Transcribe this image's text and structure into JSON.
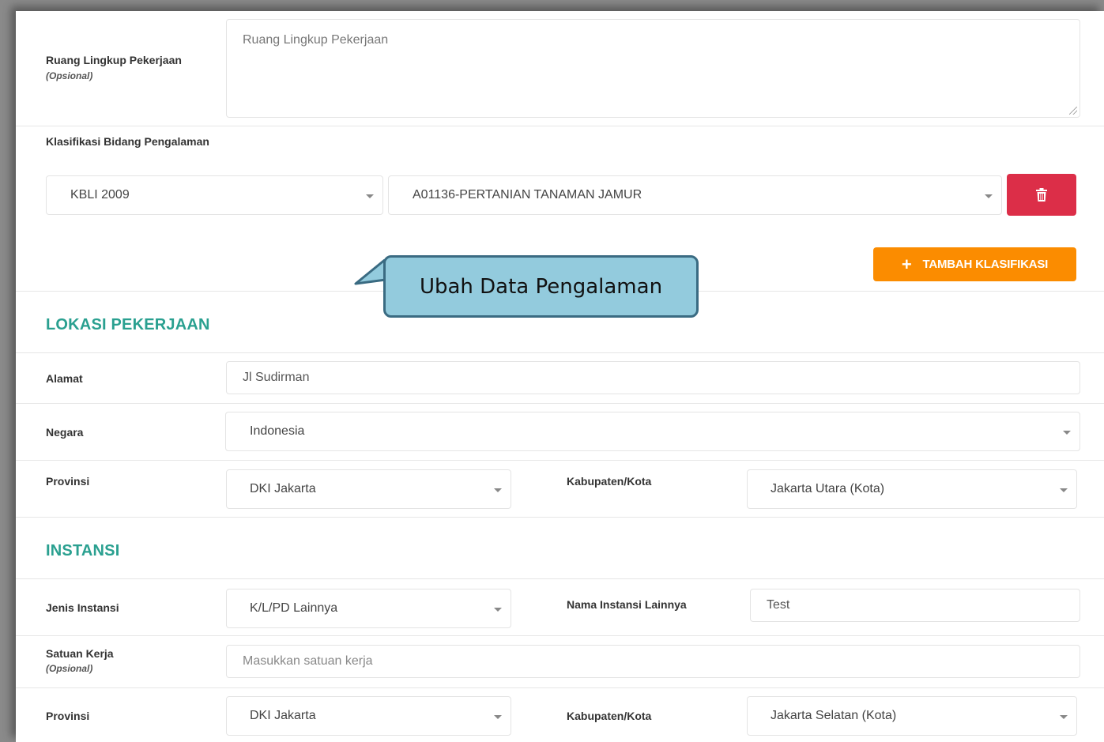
{
  "scope": {
    "label": "Ruang Lingkup Pekerjaan",
    "note": "(Opsional)",
    "placeholder": "Ruang Lingkup Pekerjaan"
  },
  "classification": {
    "label": "Klasifikasi Bidang Pengalaman",
    "type_value": "KBLI 2009",
    "code_value": "A01136-PERTANIAN TANAMAN JAMUR",
    "delete_icon": "trash-icon",
    "add_label": "TAMBAH KLASIFIKASI"
  },
  "callout": {
    "text": "Ubah Data Pengalaman"
  },
  "location": {
    "title": "LOKASI PEKERJAAN",
    "address_label": "Alamat",
    "address_value": "Jl Sudirman",
    "country_label": "Negara",
    "country_value": "Indonesia",
    "province_label": "Provinsi",
    "province_value": "DKI Jakarta",
    "city_label": "Kabupaten/Kota",
    "city_value": "Jakarta Utara (Kota)"
  },
  "instansi": {
    "title": "INSTANSI",
    "type_label": "Jenis Instansi",
    "type_value": "K/L/PD Lainnya",
    "other_label": "Nama Instansi Lainnya",
    "other_value": "Test",
    "unit_label": "Satuan Kerja",
    "unit_note": "(Opsional)",
    "unit_placeholder": "Masukkan satuan kerja",
    "province_label": "Provinsi",
    "province_value": "DKI Jakarta",
    "city_label": "Kabupaten/Kota",
    "city_value": "Jakarta Selatan (Kota)"
  },
  "colors": {
    "section": "#2aa090",
    "delete": "#dc2e48",
    "add": "#fb8c00",
    "callout": "#93cbdd"
  }
}
